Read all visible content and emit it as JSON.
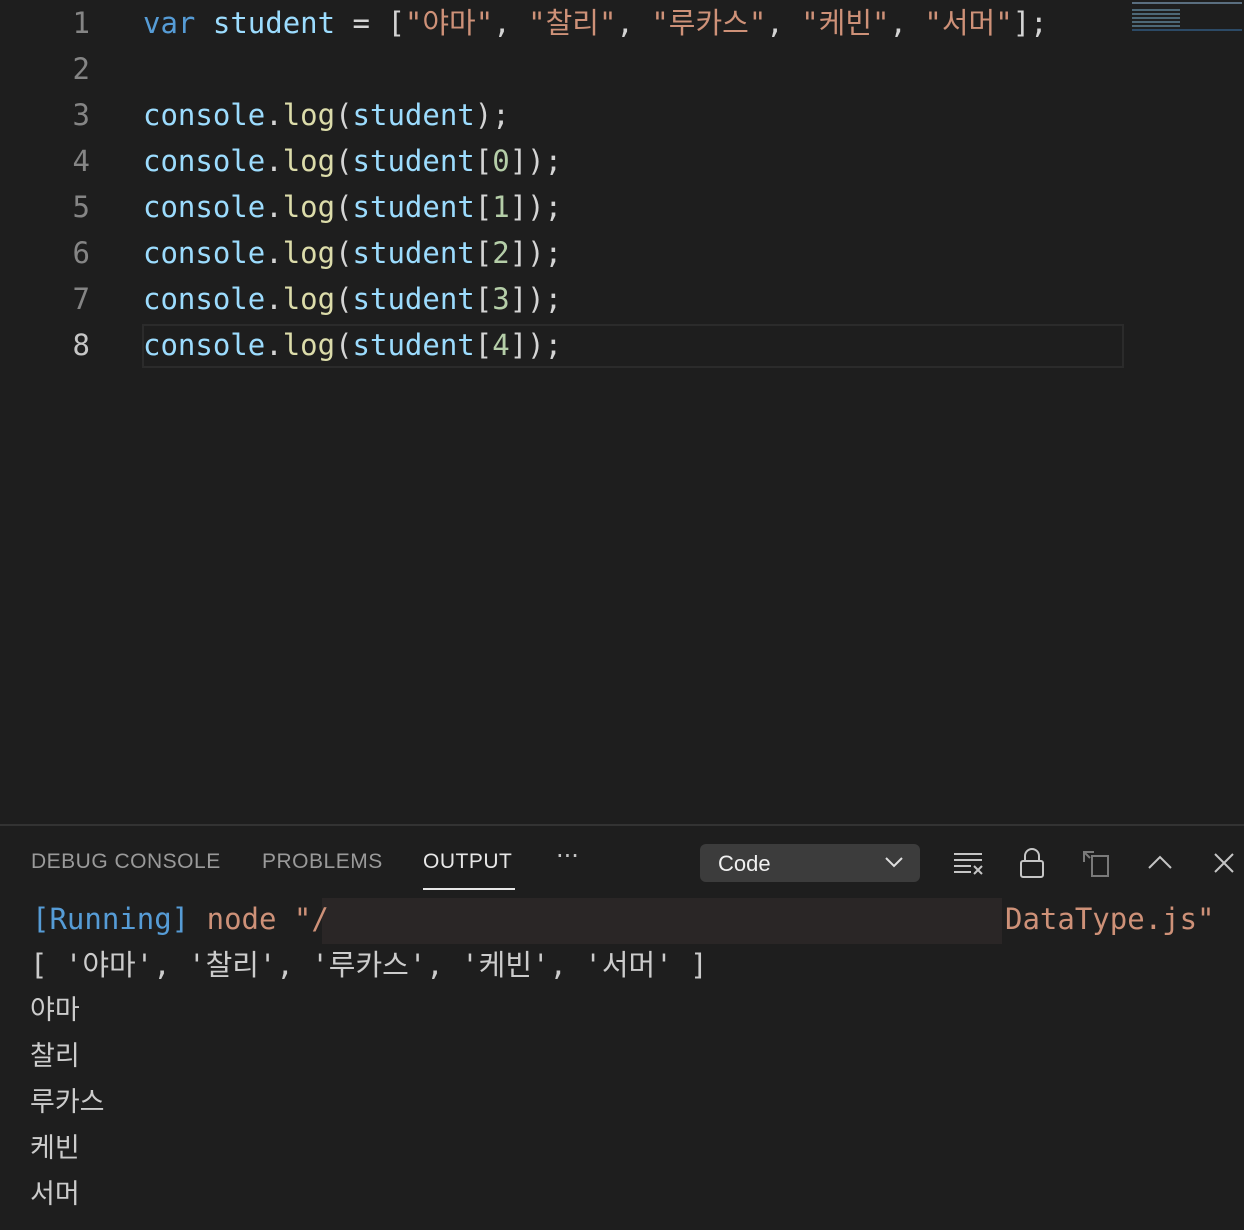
{
  "editor": {
    "lines": [
      {
        "n": "1",
        "tokens": [
          {
            "t": "var",
            "c": "kw"
          },
          {
            "t": " ",
            "c": "pun"
          },
          {
            "t": "student",
            "c": "var"
          },
          {
            "t": " = [",
            "c": "pun"
          },
          {
            "t": "\"야마\"",
            "c": "str"
          },
          {
            "t": ", ",
            "c": "pun"
          },
          {
            "t": "\"찰리\"",
            "c": "str"
          },
          {
            "t": ", ",
            "c": "pun"
          },
          {
            "t": "\"루카스\"",
            "c": "str"
          },
          {
            "t": ", ",
            "c": "pun"
          },
          {
            "t": "\"케빈\"",
            "c": "str"
          },
          {
            "t": ", ",
            "c": "pun"
          },
          {
            "t": "\"서머\"",
            "c": "str"
          },
          {
            "t": "];",
            "c": "pun"
          }
        ]
      },
      {
        "n": "2",
        "tokens": []
      },
      {
        "n": "3",
        "tokens": [
          {
            "t": "console",
            "c": "var"
          },
          {
            "t": ".",
            "c": "pun"
          },
          {
            "t": "log",
            "c": "fn"
          },
          {
            "t": "(",
            "c": "pun"
          },
          {
            "t": "student",
            "c": "var"
          },
          {
            "t": ");",
            "c": "pun"
          }
        ]
      },
      {
        "n": "4",
        "tokens": [
          {
            "t": "console",
            "c": "var"
          },
          {
            "t": ".",
            "c": "pun"
          },
          {
            "t": "log",
            "c": "fn"
          },
          {
            "t": "(",
            "c": "pun"
          },
          {
            "t": "student",
            "c": "var"
          },
          {
            "t": "[",
            "c": "pun"
          },
          {
            "t": "0",
            "c": "num"
          },
          {
            "t": "]);",
            "c": "pun"
          }
        ]
      },
      {
        "n": "5",
        "tokens": [
          {
            "t": "console",
            "c": "var"
          },
          {
            "t": ".",
            "c": "pun"
          },
          {
            "t": "log",
            "c": "fn"
          },
          {
            "t": "(",
            "c": "pun"
          },
          {
            "t": "student",
            "c": "var"
          },
          {
            "t": "[",
            "c": "pun"
          },
          {
            "t": "1",
            "c": "num"
          },
          {
            "t": "]);",
            "c": "pun"
          }
        ]
      },
      {
        "n": "6",
        "tokens": [
          {
            "t": "console",
            "c": "var"
          },
          {
            "t": ".",
            "c": "pun"
          },
          {
            "t": "log",
            "c": "fn"
          },
          {
            "t": "(",
            "c": "pun"
          },
          {
            "t": "student",
            "c": "var"
          },
          {
            "t": "[",
            "c": "pun"
          },
          {
            "t": "2",
            "c": "num"
          },
          {
            "t": "]);",
            "c": "pun"
          }
        ]
      },
      {
        "n": "7",
        "tokens": [
          {
            "t": "console",
            "c": "var"
          },
          {
            "t": ".",
            "c": "pun"
          },
          {
            "t": "log",
            "c": "fn"
          },
          {
            "t": "(",
            "c": "pun"
          },
          {
            "t": "student",
            "c": "var"
          },
          {
            "t": "[",
            "c": "pun"
          },
          {
            "t": "3",
            "c": "num"
          },
          {
            "t": "]);",
            "c": "pun"
          }
        ]
      },
      {
        "n": "8",
        "tokens": [
          {
            "t": "console",
            "c": "var"
          },
          {
            "t": ".",
            "c": "pun"
          },
          {
            "t": "log",
            "c": "fn"
          },
          {
            "t": "(",
            "c": "pun"
          },
          {
            "t": "student",
            "c": "var"
          },
          {
            "t": "[",
            "c": "pun"
          },
          {
            "t": "4",
            "c": "num"
          },
          {
            "t": "]);",
            "c": "pun"
          }
        ]
      }
    ]
  },
  "panel": {
    "tabs": [
      "DEBUG CONSOLE",
      "PROBLEMS",
      "OUTPUT"
    ],
    "active_tab": "OUTPUT",
    "more": "···",
    "channel": "Code",
    "icons": [
      "clear-output-icon",
      "lock-scroll-icon",
      "open-in-editor-icon",
      "maximize-panel-icon",
      "close-panel-icon"
    ]
  },
  "output": {
    "running_label": "[Running]",
    "command_start": "node \"/",
    "command_end": "DataType.js\"",
    "array_line": "[ '야마', '찰리', '루카스', '케빈', '서머' ]",
    "items": [
      "야마",
      "찰리",
      "루카스",
      "케빈",
      "서머"
    ]
  }
}
